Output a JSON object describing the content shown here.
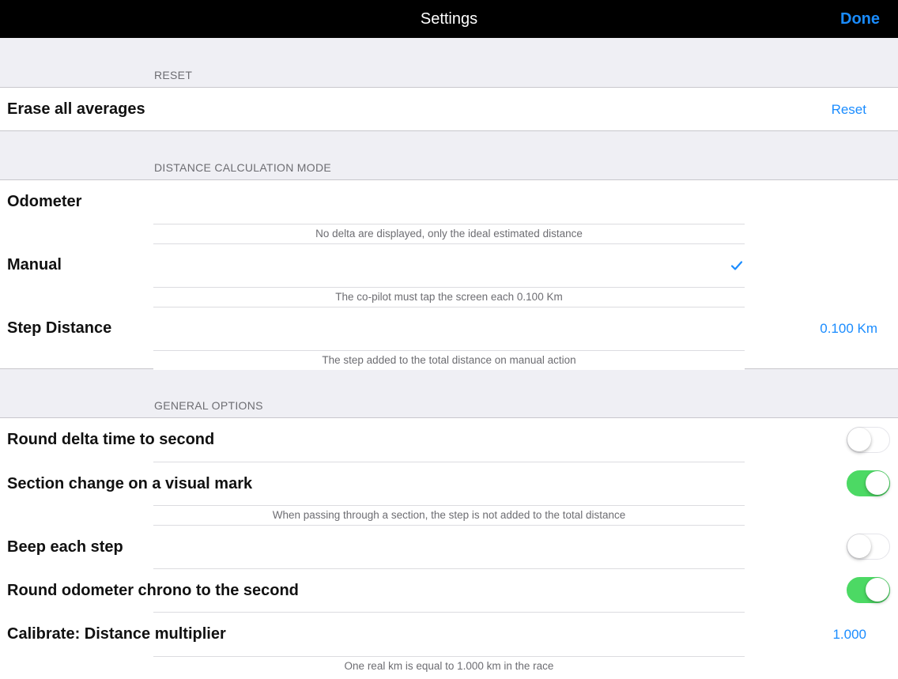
{
  "navbar": {
    "title": "Settings",
    "done_label": "Done"
  },
  "sections": {
    "reset": {
      "header": "RESET",
      "erase_label": "Erase all averages",
      "reset_action": "Reset"
    },
    "distance_mode": {
      "header": "DISTANCE CALCULATION MODE",
      "odometer_label": "Odometer",
      "odometer_footer": "No delta are displayed, only the ideal estimated distance",
      "manual_label": "Manual",
      "manual_selected": true,
      "manual_footer": "The co-pilot must tap the screen each 0.100 Km",
      "step_label": "Step Distance",
      "step_value": "0.100 Km",
      "step_footer": "The step added to the total distance on manual action"
    },
    "general": {
      "header": "GENERAL OPTIONS",
      "round_delta_label": "Round delta time to second",
      "round_delta_on": false,
      "section_change_label": "Section change on a visual mark",
      "section_change_on": true,
      "section_change_footer": "When passing through a section, the step is not added to the total distance",
      "beep_label": "Beep each step",
      "beep_on": false,
      "round_chrono_label": "Round odometer chrono to the second",
      "round_chrono_on": true,
      "calibrate_label": "Calibrate: Distance multiplier",
      "calibrate_value": "1.000",
      "calibrate_footer": "One real km is equal to 1.000 km in the race"
    }
  },
  "colors": {
    "accent": "#1a8cff",
    "toggle_on": "#4cd964",
    "navbar_bg": "#000000",
    "page_bg": "#efeff4"
  }
}
